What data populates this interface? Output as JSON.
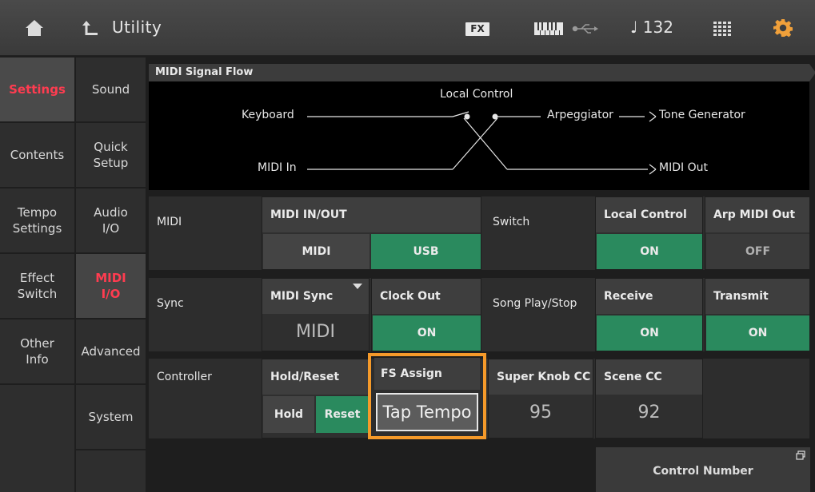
{
  "header": {
    "title": "Utility",
    "fx_label": "FX",
    "tempo": "♩ 132",
    "icons": [
      "home-icon",
      "back-icon",
      "keyboard-icon",
      "usb-icon",
      "grid-icon",
      "gear-icon"
    ]
  },
  "nav": {
    "primary": [
      {
        "label": "Settings",
        "active": true
      },
      {
        "label": "Contents",
        "active": false
      },
      {
        "label": "Tempo\nSettings",
        "active": false
      },
      {
        "label": "Effect\nSwitch",
        "active": false
      },
      {
        "label": "Other\nInfo",
        "active": false
      }
    ],
    "secondary": [
      {
        "label": "Sound",
        "active": false
      },
      {
        "label": "Quick\nSetup",
        "active": false
      },
      {
        "label": "Audio\nI/O",
        "active": false
      },
      {
        "label": "MIDI\nI/O",
        "active": true
      },
      {
        "label": "Advanced",
        "active": false
      },
      {
        "label": "System",
        "active": false
      }
    ]
  },
  "signal_flow": {
    "title": "MIDI Signal Flow",
    "keyboard": "Keyboard",
    "local_control": "Local Control",
    "arpeggiator": "Arpeggiator",
    "tone_generator": "Tone Generator",
    "midi_in": "MIDI In",
    "midi_out": "MIDI Out"
  },
  "midi_row": {
    "label": "MIDI",
    "in_out": {
      "header": "MIDI IN/OUT",
      "options": [
        "MIDI",
        "USB"
      ],
      "selected": "USB"
    },
    "switch_label": "Switch",
    "local_control": {
      "header": "Local Control",
      "value": "ON"
    },
    "arp_midi_out": {
      "header": "Arp MIDI Out",
      "value": "OFF"
    }
  },
  "sync_row": {
    "label": "Sync",
    "midi_sync": {
      "header": "MIDI Sync",
      "value": "MIDI"
    },
    "clock_out": {
      "header": "Clock Out",
      "value": "ON"
    },
    "song_label": "Song Play/Stop",
    "receive": {
      "header": "Receive",
      "value": "ON"
    },
    "transmit": {
      "header": "Transmit",
      "value": "ON"
    }
  },
  "controller_row": {
    "label": "Controller",
    "hold_reset": {
      "header": "Hold/Reset",
      "options": [
        "Hold",
        "Reset"
      ],
      "selected": "Reset"
    },
    "fs_assign": {
      "header": "FS Assign",
      "value": "Tap Tempo"
    },
    "super_knob_cc": {
      "header": "Super Knob CC",
      "value": "95"
    },
    "scene_cc": {
      "header": "Scene CC",
      "value": "92"
    }
  },
  "control_number": {
    "label": "Control Number"
  },
  "colors": {
    "accent_on": "#2a8a5e",
    "focus": "#f59a2a",
    "active_nav": "#ff3c50"
  }
}
